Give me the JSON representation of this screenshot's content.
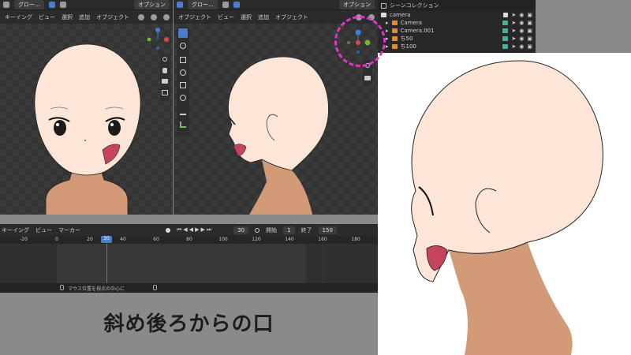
{
  "left_header": {
    "menu": [
      "キーイング",
      "ビュー",
      "選択",
      "追加",
      "オブジェクト"
    ],
    "view_mode": "グロー…",
    "options": "オプション"
  },
  "mid_header": {
    "menu": [
      "オブジェクト",
      "ビュー",
      "選択",
      "追加",
      "オブジェクト"
    ],
    "view_mode": "グロー…",
    "options": "オプション"
  },
  "outliner": {
    "title": "シーンコレクション",
    "collection": "camera",
    "items": [
      "Camera",
      "Camera.001",
      "ち50",
      "ち100"
    ]
  },
  "timeline": {
    "menu": [
      "キーイング",
      "ビュー",
      "マーカー"
    ],
    "current_frame": "30",
    "start_label": "開始",
    "start_value": "1",
    "end_label": "終了",
    "end_value": "150",
    "ticks": [
      "-20",
      "0",
      "20",
      "30",
      "40",
      "60",
      "80",
      "100",
      "120",
      "140",
      "160",
      "180"
    ]
  },
  "status_bar": {
    "hint": "マウス位置を視点の中心に"
  },
  "caption": "斜め後ろからの口",
  "colors": {
    "skin": "#fde5d8",
    "skin_shadow": "#d39a78",
    "mouth": "#c4445e",
    "gizmo_x": "#e0444b",
    "gizmo_y": "#76b52a",
    "gizmo_z": "#3e7fd8",
    "highlight": "#e035c8"
  }
}
